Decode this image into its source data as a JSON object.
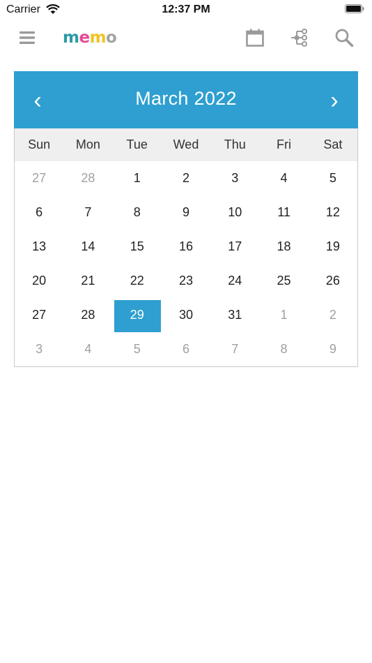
{
  "status_bar": {
    "carrier": "Carrier",
    "time": "12:37 PM"
  },
  "toolbar": {
    "logo_letters": [
      {
        "char": "m",
        "color": "#2a9aa5"
      },
      {
        "char": "e",
        "color": "#e64a93"
      },
      {
        "char": "m",
        "color": "#f2c320"
      },
      {
        "char": "o",
        "color": "#a3a3a3"
      }
    ],
    "icons": [
      "menu-icon",
      "calendar-icon",
      "tree-icon",
      "search-icon"
    ],
    "icon_color": "#9a9a9a"
  },
  "calendar": {
    "title": "March 2022",
    "prev_label": "‹",
    "next_label": "›",
    "header_color": "#2e9fd0",
    "weekdays": [
      "Sun",
      "Mon",
      "Tue",
      "Wed",
      "Thu",
      "Fri",
      "Sat"
    ],
    "weeks": [
      [
        {
          "d": "27",
          "m": true
        },
        {
          "d": "28",
          "m": true
        },
        {
          "d": "1"
        },
        {
          "d": "2"
        },
        {
          "d": "3"
        },
        {
          "d": "4"
        },
        {
          "d": "5"
        }
      ],
      [
        {
          "d": "6"
        },
        {
          "d": "7"
        },
        {
          "d": "8"
        },
        {
          "d": "9"
        },
        {
          "d": "10"
        },
        {
          "d": "11"
        },
        {
          "d": "12"
        }
      ],
      [
        {
          "d": "13"
        },
        {
          "d": "14"
        },
        {
          "d": "15"
        },
        {
          "d": "16"
        },
        {
          "d": "17"
        },
        {
          "d": "18"
        },
        {
          "d": "19"
        }
      ],
      [
        {
          "d": "20"
        },
        {
          "d": "21"
        },
        {
          "d": "22"
        },
        {
          "d": "23"
        },
        {
          "d": "24"
        },
        {
          "d": "25"
        },
        {
          "d": "26"
        }
      ],
      [
        {
          "d": "27"
        },
        {
          "d": "28"
        },
        {
          "d": "29",
          "s": true
        },
        {
          "d": "30"
        },
        {
          "d": "31"
        },
        {
          "d": "1",
          "m": true
        },
        {
          "d": "2",
          "m": true
        }
      ],
      [
        {
          "d": "3",
          "m": true
        },
        {
          "d": "4",
          "m": true
        },
        {
          "d": "5",
          "m": true
        },
        {
          "d": "6",
          "m": true
        },
        {
          "d": "7",
          "m": true
        },
        {
          "d": "8",
          "m": true
        },
        {
          "d": "9",
          "m": true
        }
      ]
    ]
  }
}
